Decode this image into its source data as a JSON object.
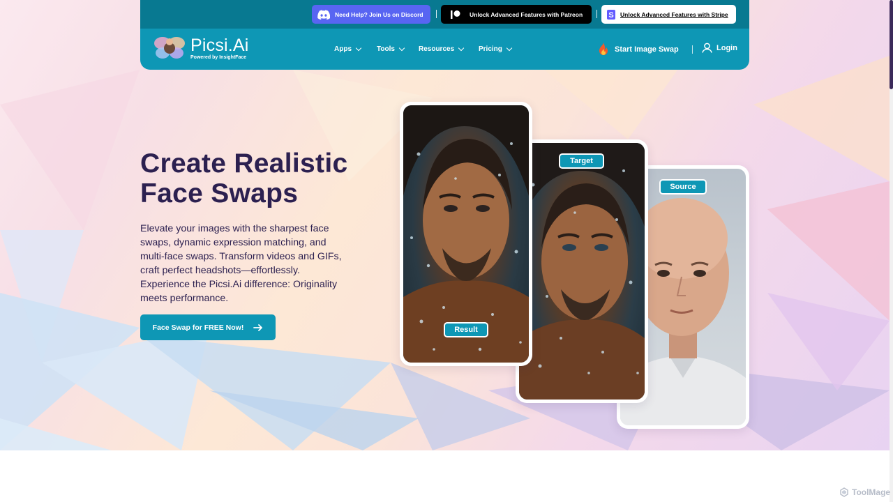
{
  "topbar": {
    "discord_label": "Need Help? Join Us on Discord",
    "patreon_label": "Unlock Advanced Features with Patreon",
    "stripe_label": "Unlock Advanced Features with Stripe"
  },
  "logo": {
    "title": "Picsi.Ai",
    "subtitle": "Powered by InsightFace"
  },
  "nav": {
    "items": [
      {
        "label": "Apps"
      },
      {
        "label": "Tools"
      },
      {
        "label": "Resources"
      },
      {
        "label": "Pricing"
      }
    ],
    "start_swap": "Start Image Swap",
    "login": "Login"
  },
  "hero": {
    "title_line1": "Create Realistic",
    "title_line2": "Face Swaps",
    "description": "Elevate your images with the sharpest face swaps, dynamic expression matching, and multi-face swaps. Transform videos and GIFs, craft perfect headshots—effortlessly. Experience the Picsi.Ai difference: Originality meets performance.",
    "cta_label": "Face Swap for FREE Now!"
  },
  "cards": {
    "result_tag": "Result",
    "target_tag": "Target",
    "source_tag": "Source"
  },
  "watermark": "ToolMage",
  "colors": {
    "brand": "#0e97b5",
    "brand_dark": "#087991",
    "title": "#2c2050",
    "discord": "#5865f2"
  },
  "icons": [
    "discord-icon",
    "patreon-icon",
    "stripe-icon",
    "fire-icon",
    "user-icon",
    "arrow-right-icon",
    "chevron-down-icon"
  ]
}
